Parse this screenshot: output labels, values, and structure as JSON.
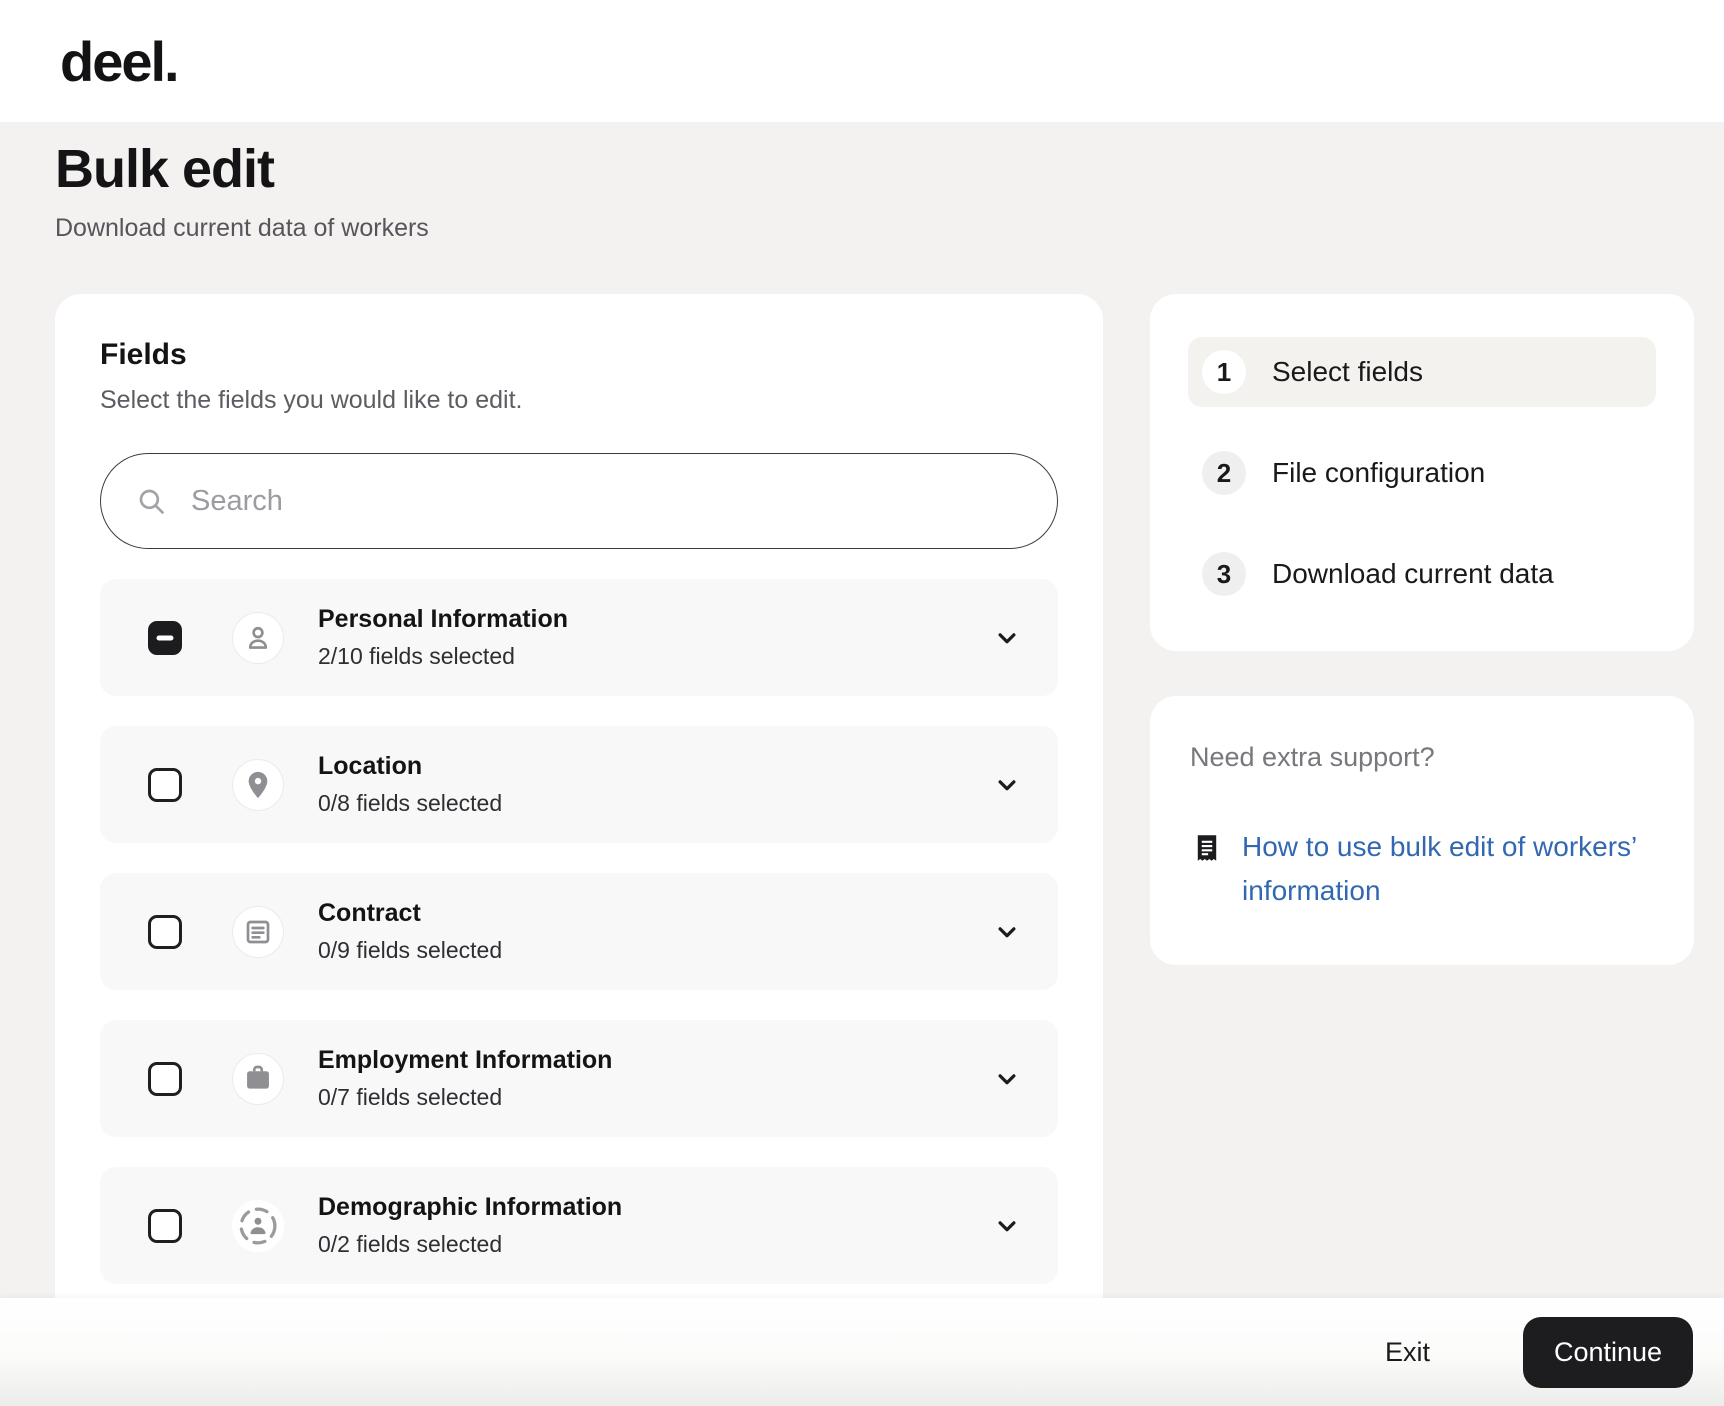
{
  "header": {
    "logo": "deel."
  },
  "page": {
    "title": "Bulk edit",
    "subtitle": "Download current data of workers"
  },
  "fields_panel": {
    "title": "Fields",
    "subtitle": "Select the fields you would like to edit.",
    "search_placeholder": "Search",
    "categories": [
      {
        "label": "Personal Information",
        "status": "2/10 fields selected",
        "icon": "person-icon",
        "checkbox_state": "indeterminate"
      },
      {
        "label": "Location",
        "status": "0/8 fields selected",
        "icon": "location-pin-icon",
        "checkbox_state": "unchecked"
      },
      {
        "label": "Contract",
        "status": "0/9 fields selected",
        "icon": "contract-document-icon",
        "checkbox_state": "unchecked"
      },
      {
        "label": "Employment Information",
        "status": "0/7 fields selected",
        "icon": "briefcase-icon",
        "checkbox_state": "unchecked"
      },
      {
        "label": "Demographic Information",
        "status": "0/2 fields selected",
        "icon": "demographic-person-icon",
        "checkbox_state": "unchecked"
      }
    ]
  },
  "steps_panel": {
    "steps": [
      {
        "number": "1",
        "label": "Select fields",
        "active": true
      },
      {
        "number": "2",
        "label": "File configuration",
        "active": false
      },
      {
        "number": "3",
        "label": "Download current data",
        "active": false
      }
    ]
  },
  "support_panel": {
    "title": "Need extra support?",
    "link_text": "How to use bulk edit of workers’ information"
  },
  "footer": {
    "exit_label": "Exit",
    "continue_label": "Continue"
  },
  "colors": {
    "accent_black": "#1d1d1f",
    "link_blue": "#3268b1",
    "page_bg": "#f4f2f0",
    "row_bg": "#f8f8f8",
    "icon_gray": "#8e8e93",
    "active_step_bg": "#f4f2ee"
  }
}
